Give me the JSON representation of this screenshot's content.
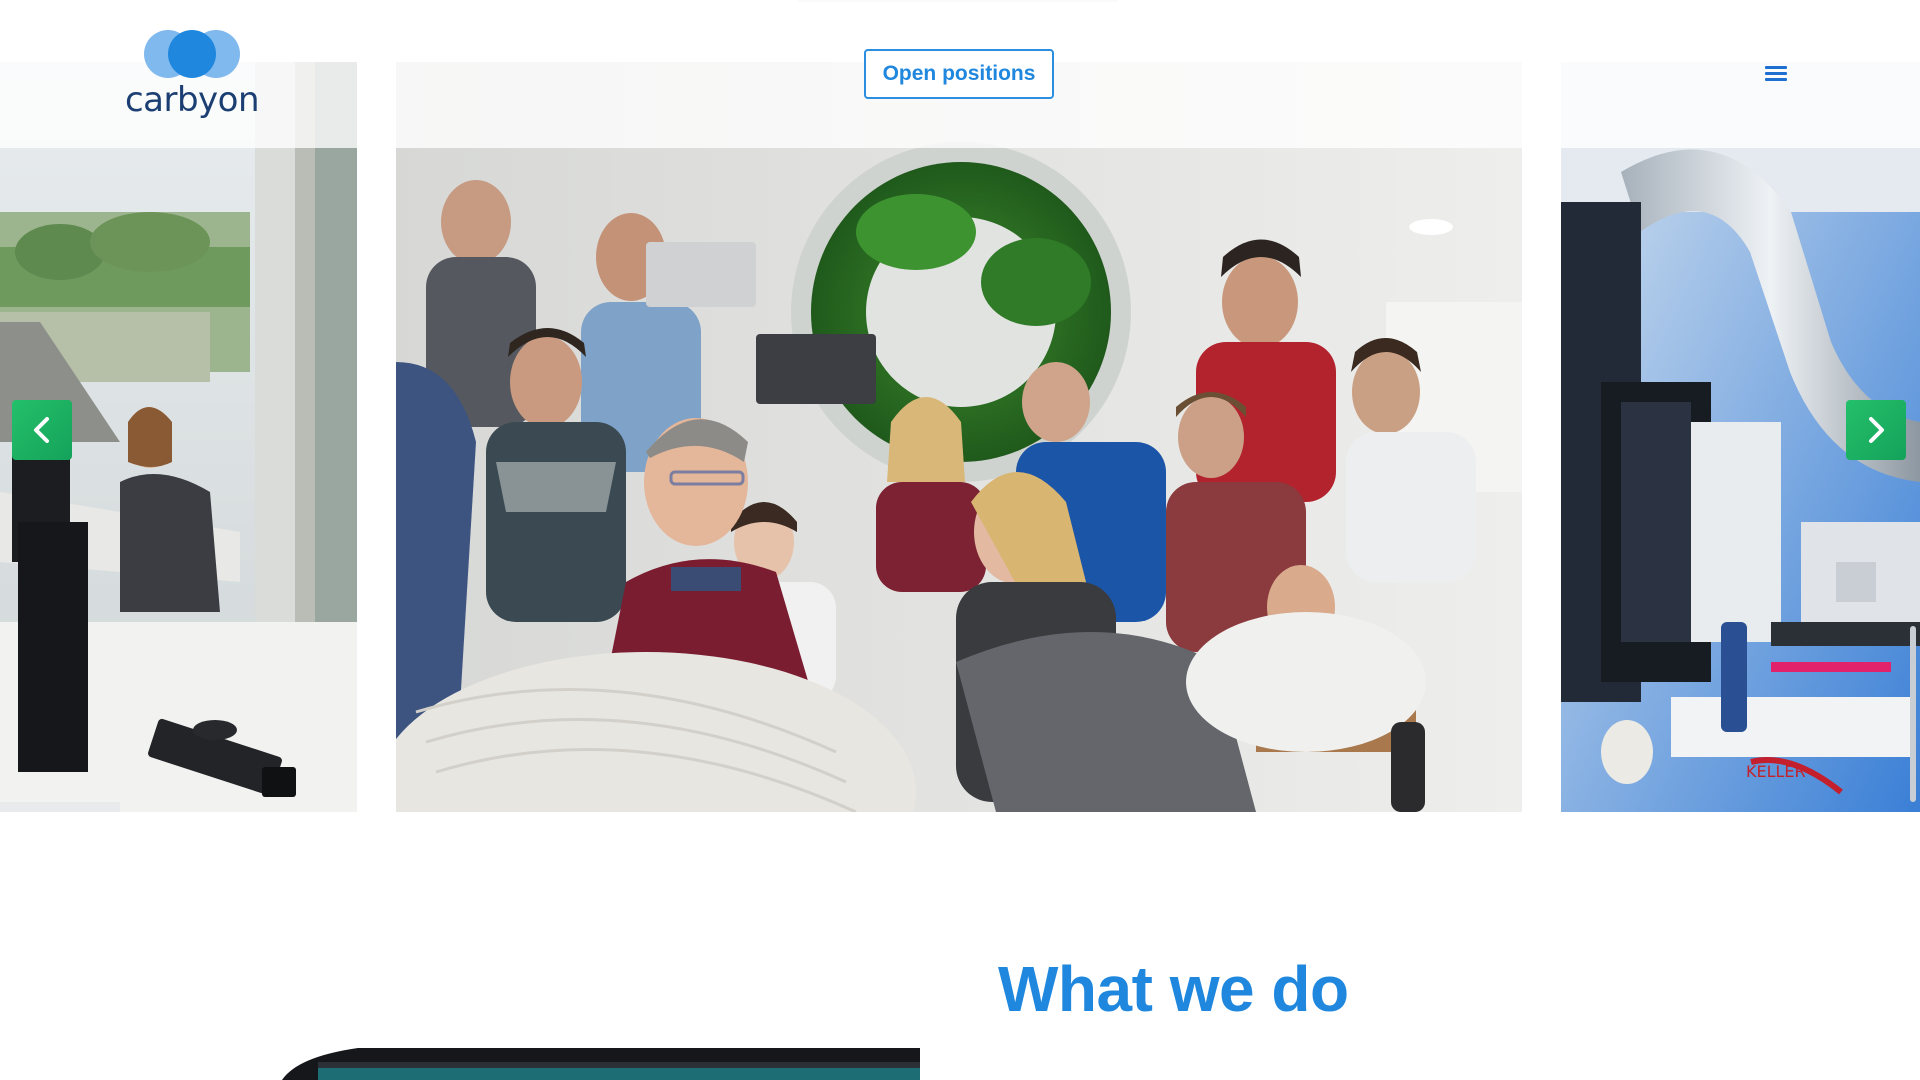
{
  "brand": {
    "name": "carbyon",
    "logo_icon": "overlapping-circles-icon",
    "colors": {
      "primary": "#1f87dd",
      "dark": "#1c3f73",
      "accent_green": "#1fb463"
    }
  },
  "header": {
    "cta_label": "Open positions",
    "menu_icon": "hamburger-menu-icon"
  },
  "carousel": {
    "slides": [
      {
        "subject": "office-desk-photo"
      },
      {
        "subject": "team-meeting-photo"
      },
      {
        "subject": "lab-equipment-photo"
      }
    ],
    "prev_icon": "chevron-left-icon",
    "next_icon": "chevron-right-icon"
  },
  "section": {
    "title": "What we do"
  }
}
